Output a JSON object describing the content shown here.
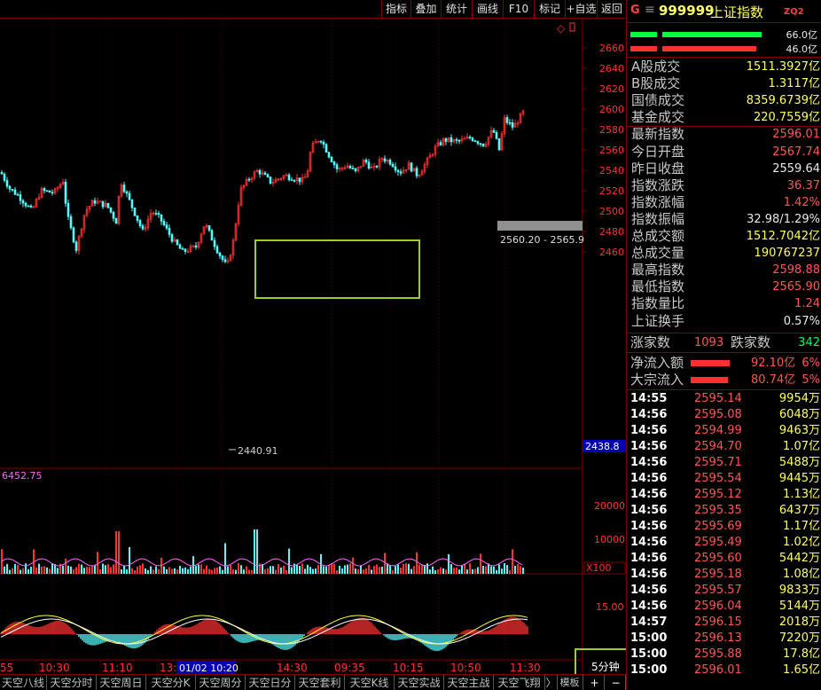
{
  "toolbar": {
    "items": [
      "指标",
      "叠加",
      "统计",
      "画线",
      "F10",
      "标记",
      "+自选",
      "返回"
    ]
  },
  "header": {
    "code_letter": "G",
    "code": "999999",
    "name": "上证指数",
    "zq": "ZQ2",
    "turnover_a": "66.0亿",
    "turnover_b": "46.0亿"
  },
  "stats": [
    {
      "label": "A股成交",
      "value": "1511.3927亿",
      "color": "#ffff60"
    },
    {
      "label": "B股成交",
      "value": "1.3117亿",
      "color": "#ffff60"
    },
    {
      "label": "国债成交",
      "value": "8359.6739亿",
      "color": "#ffff60"
    },
    {
      "label": "基金成交",
      "value": "220.7559亿",
      "color": "#ffff60"
    },
    {
      "label": "最新指数",
      "value": "2596.01",
      "color": "#ff5555"
    },
    {
      "label": "今日开盘",
      "value": "2567.74",
      "color": "#ff5555"
    },
    {
      "label": "昨日收盘",
      "value": "2559.64",
      "color": "#e8e8e8"
    },
    {
      "label": "指数涨跌",
      "value": "36.37",
      "color": "#ff5555"
    },
    {
      "label": "指数涨幅",
      "value": "1.42%",
      "color": "#ff5555"
    },
    {
      "label": "指数振幅",
      "value": "32.98/1.29%",
      "color": "#e8e8e8"
    },
    {
      "label": "总成交额",
      "value": "1512.7042亿",
      "color": "#ffff60"
    },
    {
      "label": "总成交量",
      "value": "190767237",
      "color": "#ffff60"
    },
    {
      "label": "最高指数",
      "value": "2598.88",
      "color": "#ff5555"
    },
    {
      "label": "最低指数",
      "value": "2565.90",
      "color": "#ff5555"
    },
    {
      "label": "指数量比",
      "value": "1.24",
      "color": "#ff5555"
    },
    {
      "label": "上证换手",
      "value": "0.57%",
      "color": "#e8e8e8"
    }
  ],
  "updown": {
    "up_label": "涨家数",
    "up": "1093",
    "down_label": "跌家数",
    "down": "342"
  },
  "flows": [
    {
      "label": "净流入额",
      "value": "92.10亿",
      "pct": "6%"
    },
    {
      "label": "大宗流入",
      "value": "80.74亿",
      "pct": "5%"
    }
  ],
  "ticks": [
    {
      "t": "14:55",
      "p": "2595.14",
      "q": "9954万"
    },
    {
      "t": "14:56",
      "p": "2595.08",
      "q": "6048万"
    },
    {
      "t": "14:56",
      "p": "2594.99",
      "q": "9463万"
    },
    {
      "t": "14:56",
      "p": "2594.70",
      "q": "1.07亿"
    },
    {
      "t": "14:56",
      "p": "2595.71",
      "q": "5488万"
    },
    {
      "t": "14:56",
      "p": "2595.54",
      "q": "9445万"
    },
    {
      "t": "14:56",
      "p": "2595.12",
      "q": "1.13亿"
    },
    {
      "t": "14:56",
      "p": "2595.35",
      "q": "6437万"
    },
    {
      "t": "14:56",
      "p": "2595.69",
      "q": "1.17亿"
    },
    {
      "t": "14:56",
      "p": "2595.49",
      "q": "1.02亿"
    },
    {
      "t": "14:56",
      "p": "2595.60",
      "q": "5442万"
    },
    {
      "t": "14:56",
      "p": "2595.18",
      "q": "1.08亿"
    },
    {
      "t": "14:56",
      "p": "2595.57",
      "q": "9833万"
    },
    {
      "t": "14:56",
      "p": "2596.04",
      "q": "5144万"
    },
    {
      "t": "14:57",
      "p": "2596.15",
      "q": "2018万"
    },
    {
      "t": "15:00",
      "p": "2596.13",
      "q": "7220万"
    },
    {
      "t": "15:00",
      "p": "2595.88",
      "q": "17.8亿"
    },
    {
      "t": "15:00",
      "p": "2596.01",
      "q": "1.65亿"
    }
  ],
  "chart": {
    "y_ticks": [
      "2660",
      "2640",
      "2620",
      "2600",
      "2580",
      "2560",
      "2540",
      "2520",
      "2500",
      "2480",
      "2460"
    ],
    "x_labels": [
      "55",
      "10:30",
      "11:10",
      "13:",
      "14:30",
      "09:35",
      "10:15",
      "10:50",
      "11:30"
    ],
    "date_cursor": "01/02 10:20",
    "low_label": "2440.91",
    "range_label": "2560.20 - 2565.9",
    "price_tag": "2438.8",
    "vol_value": "6452.75",
    "vol_ticks": [
      "20000",
      "10000"
    ],
    "vol_unit": "X100",
    "ind_tick": "15.00",
    "period": "5分钟",
    "colors": {
      "up": "#ff3232",
      "down": "#54fcfc",
      "frame": "#800000",
      "highlight": "#9acd32"
    }
  },
  "bottom_tabs": [
    "天空八线",
    "天空分时",
    "天空周日",
    "天空分K",
    "天空周分",
    "天空日分",
    "天空套利",
    "天空K线",
    "天空实战",
    "天空主战",
    "天空飞翔"
  ],
  "bottom_extra": {
    "arrow": "〉",
    "mode": "模板",
    "plus": "+",
    "minus": "−"
  }
}
